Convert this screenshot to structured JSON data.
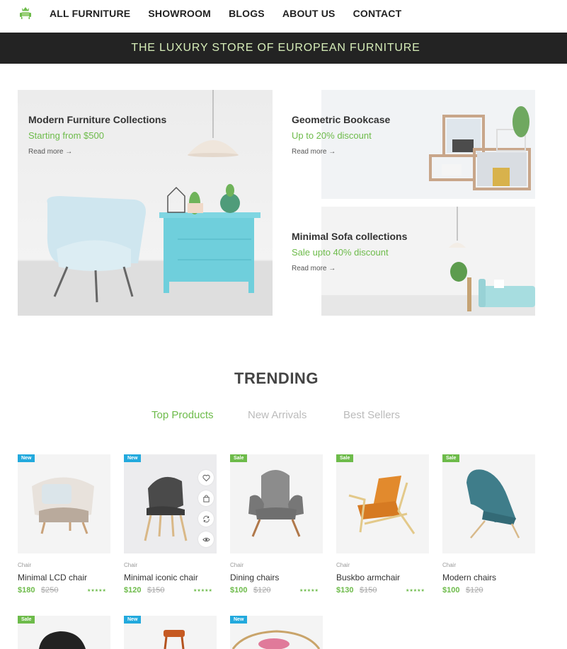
{
  "nav": {
    "items": [
      {
        "label": "ALL FURNITURE"
      },
      {
        "label": "SHOWROOM"
      },
      {
        "label": "BLOGS"
      },
      {
        "label": "ABOUT US"
      },
      {
        "label": "CONTACT"
      }
    ]
  },
  "banner": {
    "text": "THE LUXURY STORE OF EUROPEAN FURNITURE"
  },
  "hero": {
    "main": {
      "title": "Modern Furniture Collections",
      "subtitle": "Starting from $500",
      "link": "Read more"
    },
    "top": {
      "title": "Geometric Bookcase",
      "subtitle": "Up to 20% discount",
      "link": "Read more"
    },
    "bottom": {
      "title": "Minimal Sofa collections",
      "subtitle": "Sale upto 40% discount",
      "link": "Read more"
    }
  },
  "trending": {
    "title": "TRENDING",
    "tabs": [
      {
        "label": "Top Products",
        "active": true
      },
      {
        "label": "New Arrivals",
        "active": false
      },
      {
        "label": "Best Sellers",
        "active": false
      }
    ]
  },
  "products": [
    {
      "badge": "New",
      "category": "Chair",
      "name": "Minimal LCD chair",
      "price": "$180",
      "old_price": "$250",
      "stars": "★★★★★"
    },
    {
      "badge": "New",
      "category": "Chair",
      "name": "Minimal iconic chair",
      "price": "$120",
      "old_price": "$150",
      "stars": "★★★★★"
    },
    {
      "badge": "Sale",
      "category": "Chair",
      "name": "Dining chairs",
      "price": "$100",
      "old_price": "$120",
      "stars": "★★★★★"
    },
    {
      "badge": "Sale",
      "category": "Chair",
      "name": "Buskbo armchair",
      "price": "$130",
      "old_price": "$150",
      "stars": "★★★★★"
    },
    {
      "badge": "Sale",
      "category": "Chair",
      "name": "Modern chairs",
      "price": "$100",
      "old_price": "$120",
      "stars": ""
    }
  ],
  "products_row2": [
    {
      "badge": "Sale"
    },
    {
      "badge": "New"
    },
    {
      "badge": "New"
    }
  ],
  "colors": {
    "accent": "#6dbb4a",
    "new_badge": "#22a9dd",
    "banner_bg": "#232323"
  }
}
